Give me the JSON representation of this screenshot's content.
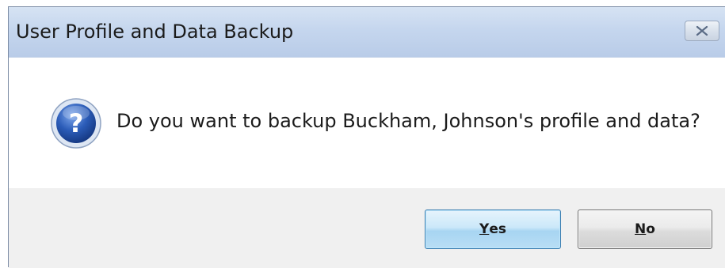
{
  "dialog": {
    "title": "User Profile and Data Backup",
    "message": "Do you want to backup Buckham, Johnson's profile and data?",
    "icon": "question-icon",
    "buttons": {
      "yes": {
        "mnemonic": "Y",
        "rest": "es"
      },
      "no": {
        "mnemonic": "N",
        "rest": "o"
      }
    }
  },
  "colors": {
    "titlebar": "#c5d6ee",
    "footer": "#f0f0f0",
    "icon_blue": "#2b5cb8",
    "default_button_border": "#3c7fb1"
  }
}
